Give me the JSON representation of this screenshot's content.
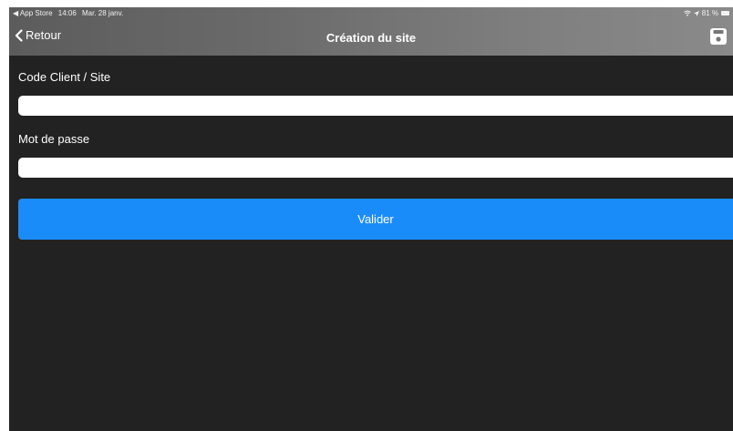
{
  "status_bar": {
    "back_app": "◀ App Store",
    "time": "14:06",
    "date": "Mar. 28 janv.",
    "battery": "81 %"
  },
  "nav": {
    "back_label": "Retour",
    "title": "Création du site",
    "save_icon": "floppy-disk-icon"
  },
  "form": {
    "client_label": "Code Client / Site",
    "client_value": "",
    "password_label": "Mot de passe",
    "password_value": "",
    "submit_label": "Valider"
  },
  "colors": {
    "background": "#222222",
    "accent": "#1a8cf9",
    "header": "#6e6e6e"
  }
}
